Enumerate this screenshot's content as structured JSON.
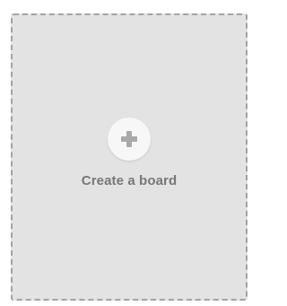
{
  "create_board": {
    "label": "Create a board",
    "icon": "plus-icon",
    "colors": {
      "card_background": "#e3e3e3",
      "dashed_border": "#a3a3a3",
      "circle_background": "#f7f7f7",
      "plus": "#a8a8a8",
      "label": "#777777"
    }
  }
}
